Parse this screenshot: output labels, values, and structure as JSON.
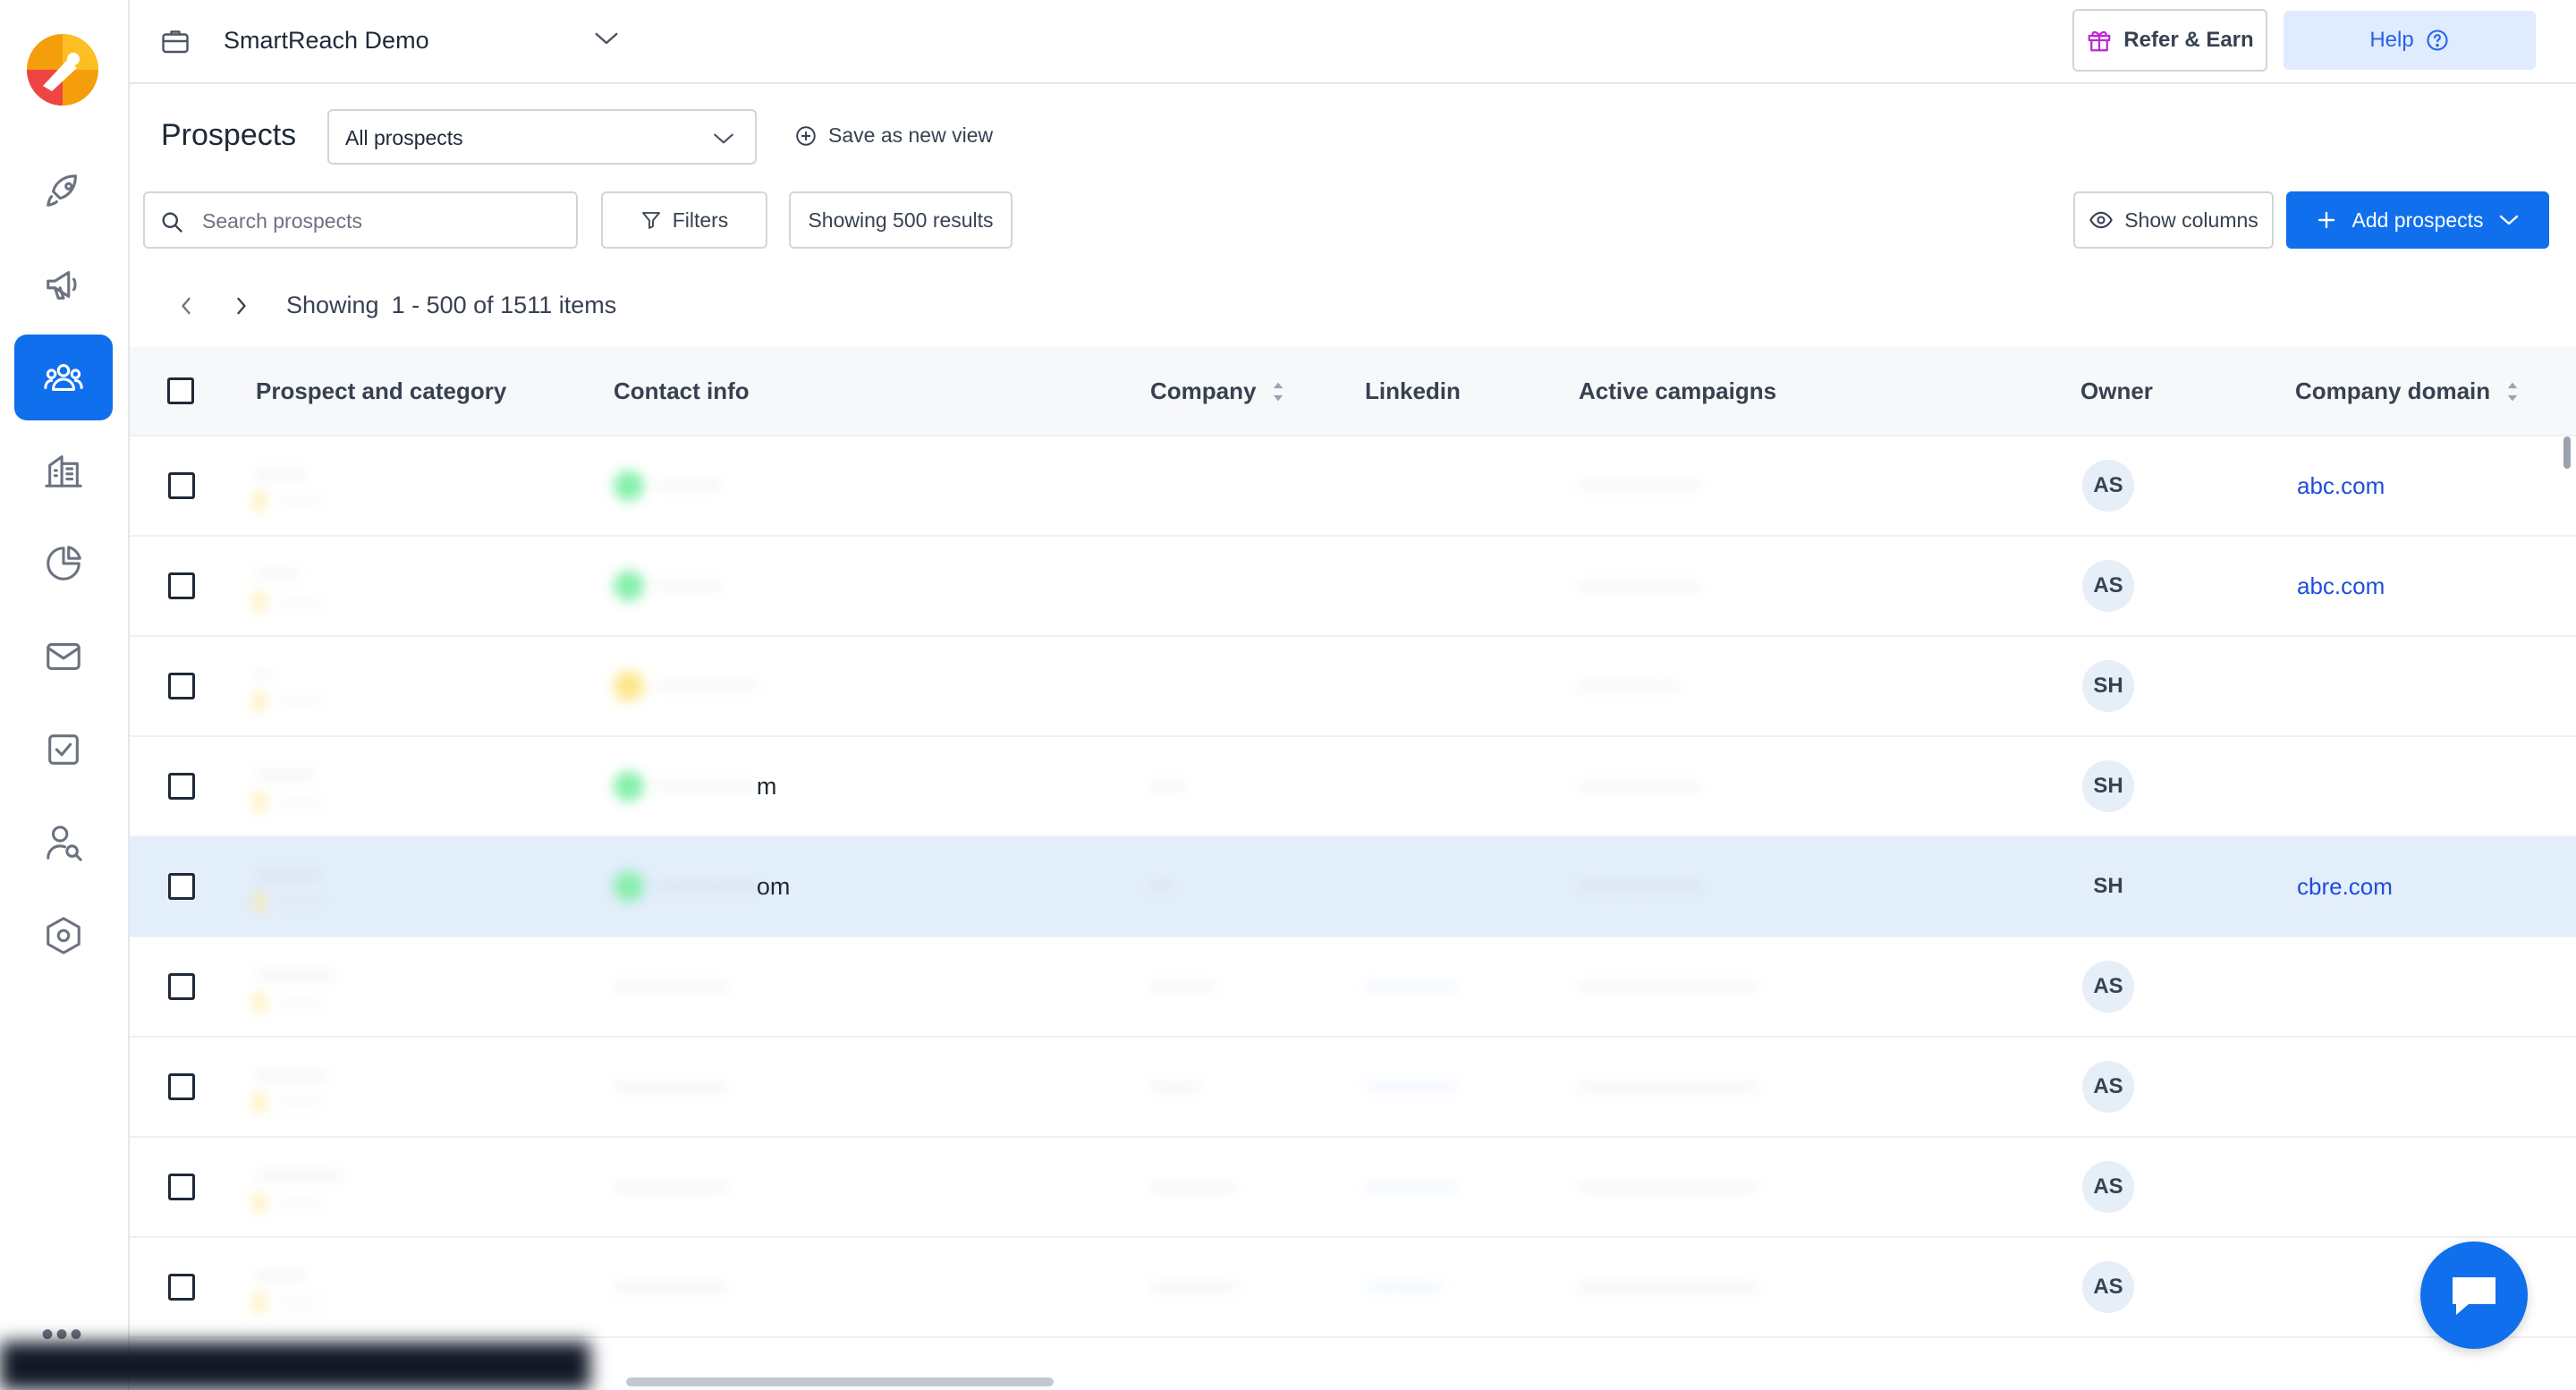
{
  "workspace": {
    "name": "SmartReach Demo"
  },
  "topbar": {
    "refer_label": "Refer & Earn",
    "help_label": "Help"
  },
  "page": {
    "title": "Prospects"
  },
  "view_select": {
    "selected": "All prospects"
  },
  "save_view": {
    "label": "Save as new view"
  },
  "toolbar": {
    "search_placeholder": "Search prospects",
    "filters_label": "Filters",
    "showing_results_label": "Showing 500 results",
    "show_columns_label": "Show columns",
    "add_prospects_label": "Add prospects"
  },
  "pagination": {
    "prefix": "Showing",
    "range": "1 - 500 of 1511 items"
  },
  "table": {
    "columns": {
      "prospect": "Prospect and category",
      "contact": "Contact info",
      "company": "Company",
      "linkedin": "Linkedin",
      "campaigns": "Active campaigns",
      "owner": "Owner",
      "domain": "Company domain"
    },
    "rows": [
      {
        "owner": "AS",
        "domain": "abc.com",
        "contact_suffix": ""
      },
      {
        "owner": "AS",
        "domain": "abc.com",
        "contact_suffix": ""
      },
      {
        "owner": "SH",
        "domain": "",
        "contact_suffix": ""
      },
      {
        "owner": "SH",
        "domain": "",
        "contact_suffix": "m"
      },
      {
        "owner": "SH",
        "domain": "cbre.com",
        "contact_suffix": "om"
      },
      {
        "owner": "AS",
        "domain": "",
        "contact_suffix": ""
      },
      {
        "owner": "AS",
        "domain": "",
        "contact_suffix": ""
      },
      {
        "owner": "AS",
        "domain": "",
        "contact_suffix": ""
      },
      {
        "owner": "AS",
        "domain": "",
        "contact_suffix": ""
      }
    ]
  },
  "colors": {
    "primary": "#0f6fec",
    "highlight_row": "#e3eefb",
    "link": "#1d4ed8"
  }
}
